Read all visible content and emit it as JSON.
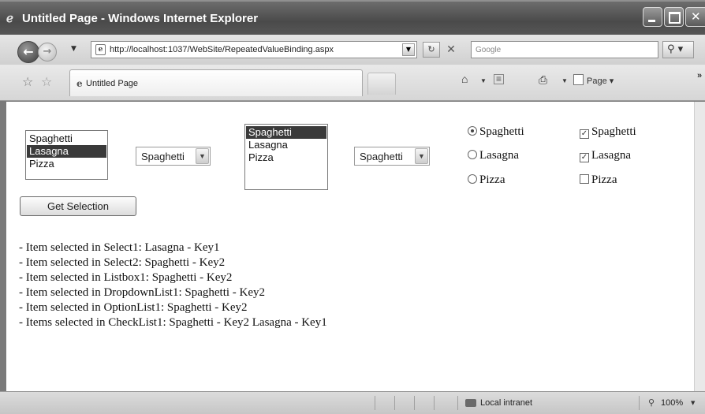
{
  "window": {
    "title": "Untitled Page - Windows Internet Explorer"
  },
  "address_bar": {
    "url": "http://localhost:1037/WebSite/RepeatedValueBinding.aspx",
    "search_placeholder": "Google"
  },
  "tab": {
    "label": "Untitled Page"
  },
  "command_bar": {
    "page_label": "Page"
  },
  "form": {
    "select1": {
      "options": [
        "Spaghetti",
        "Lasagna",
        "Pizza"
      ],
      "selected": "Lasagna"
    },
    "select2": {
      "value": "Spaghetti"
    },
    "listbox1": {
      "options": [
        "Spaghetti",
        "Lasagna",
        "Pizza"
      ],
      "selected": "Spaghetti"
    },
    "dropdownlist1": {
      "value": "Spaghetti"
    },
    "optionlist1": {
      "options": [
        "Spaghetti",
        "Lasagna",
        "Pizza"
      ],
      "checked": "Spaghetti"
    },
    "checklist1": {
      "options": [
        "Spaghetti",
        "Lasagna",
        "Pizza"
      ],
      "checked": [
        true,
        true,
        false
      ]
    },
    "get_selection_label": "Get Selection"
  },
  "results": [
    "- Item selected in Select1: Lasagna - Key1",
    "- Item selected in Select2: Spaghetti - Key2",
    "- Item selected in Listbox1: Spaghetti - Key2",
    "- Item selected in DropdownList1: Spaghetti - Key2",
    "- Item selected in OptionList1: Spaghetti - Key2",
    "- Items selected in CheckList1: Spaghetti - Key2 Lasagna - Key1"
  ],
  "status_bar": {
    "zone": "Local intranet",
    "zoom": "100%"
  }
}
